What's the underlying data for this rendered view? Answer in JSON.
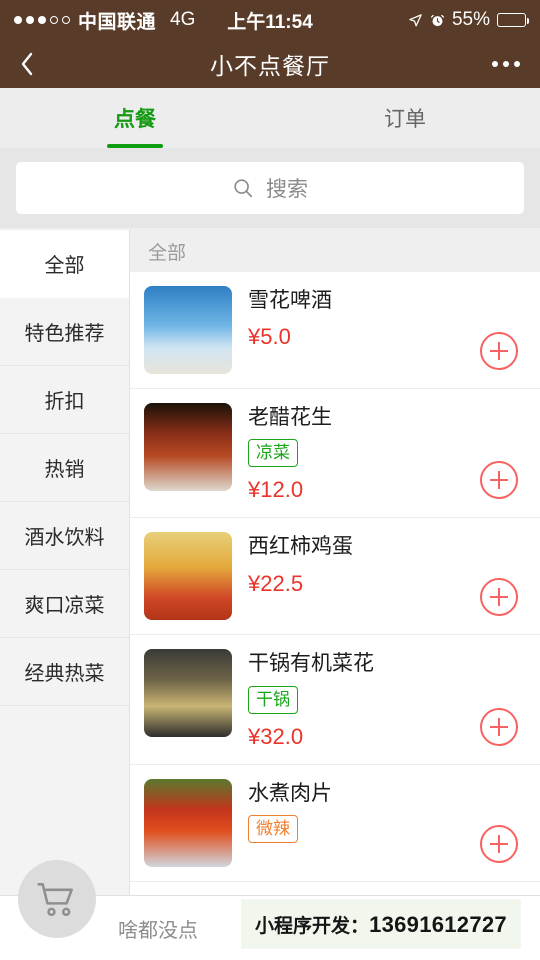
{
  "status_bar": {
    "carrier": "中国联通",
    "network": "4G",
    "time": "上午11:54",
    "battery_percent": "55%",
    "battery_level": 55,
    "signal_dots_filled": 3,
    "signal_dots_total": 5,
    "icons": [
      "location-arrow-icon",
      "alarm-clock-icon",
      "battery-icon"
    ]
  },
  "navbar": {
    "title": "小不点餐厅",
    "back_icon": "chevron-left-icon",
    "more_icon": "more-horizontal-icon",
    "background": "#583c29"
  },
  "tabs": [
    {
      "label": "点餐",
      "active": true
    },
    {
      "label": "订单",
      "active": false
    }
  ],
  "accent": {
    "green": "#1aad19",
    "red": "#e8342a",
    "plus": "#f76260",
    "orange": "#f08030"
  },
  "search": {
    "placeholder": "搜索",
    "value": "",
    "icon": "search-icon"
  },
  "sidebar": {
    "items": [
      {
        "label": "全部",
        "active": true
      },
      {
        "label": "特色推荐",
        "active": false
      },
      {
        "label": "折扣",
        "active": false
      },
      {
        "label": "热销",
        "active": false
      },
      {
        "label": "酒水饮料",
        "active": false
      },
      {
        "label": "爽口凉菜",
        "active": false
      },
      {
        "label": "经典热菜",
        "active": false
      }
    ]
  },
  "list": {
    "section_header": "全部",
    "items": [
      {
        "name": "雪花啤酒",
        "tag": "",
        "price": "¥5.0",
        "add_icon": "plus-circle-icon",
        "thumb": "beer"
      },
      {
        "name": "老醋花生",
        "tag": "凉菜",
        "tag_type": "cold",
        "price": "¥12.0",
        "add_icon": "plus-circle-icon",
        "thumb": "peanut"
      },
      {
        "name": "西红柿鸡蛋",
        "tag": "",
        "price": "¥22.5",
        "add_icon": "plus-circle-icon",
        "thumb": "tomato-egg"
      },
      {
        "name": "干锅有机菜花",
        "tag": "干锅",
        "tag_type": "cold",
        "price": "¥32.0",
        "add_icon": "plus-circle-icon",
        "thumb": "dry-pot"
      },
      {
        "name": "水煮肉片",
        "tag": "微辣",
        "tag_type": "spicy",
        "price": "",
        "add_icon": "plus-circle-icon",
        "thumb": "boiled-pork"
      }
    ]
  },
  "bottom_bar": {
    "cart_icon": "shopping-cart-icon",
    "empty_label": "啥都没点"
  },
  "promo_overlay": {
    "label": "小程序开发：",
    "phone": "13691612727"
  }
}
